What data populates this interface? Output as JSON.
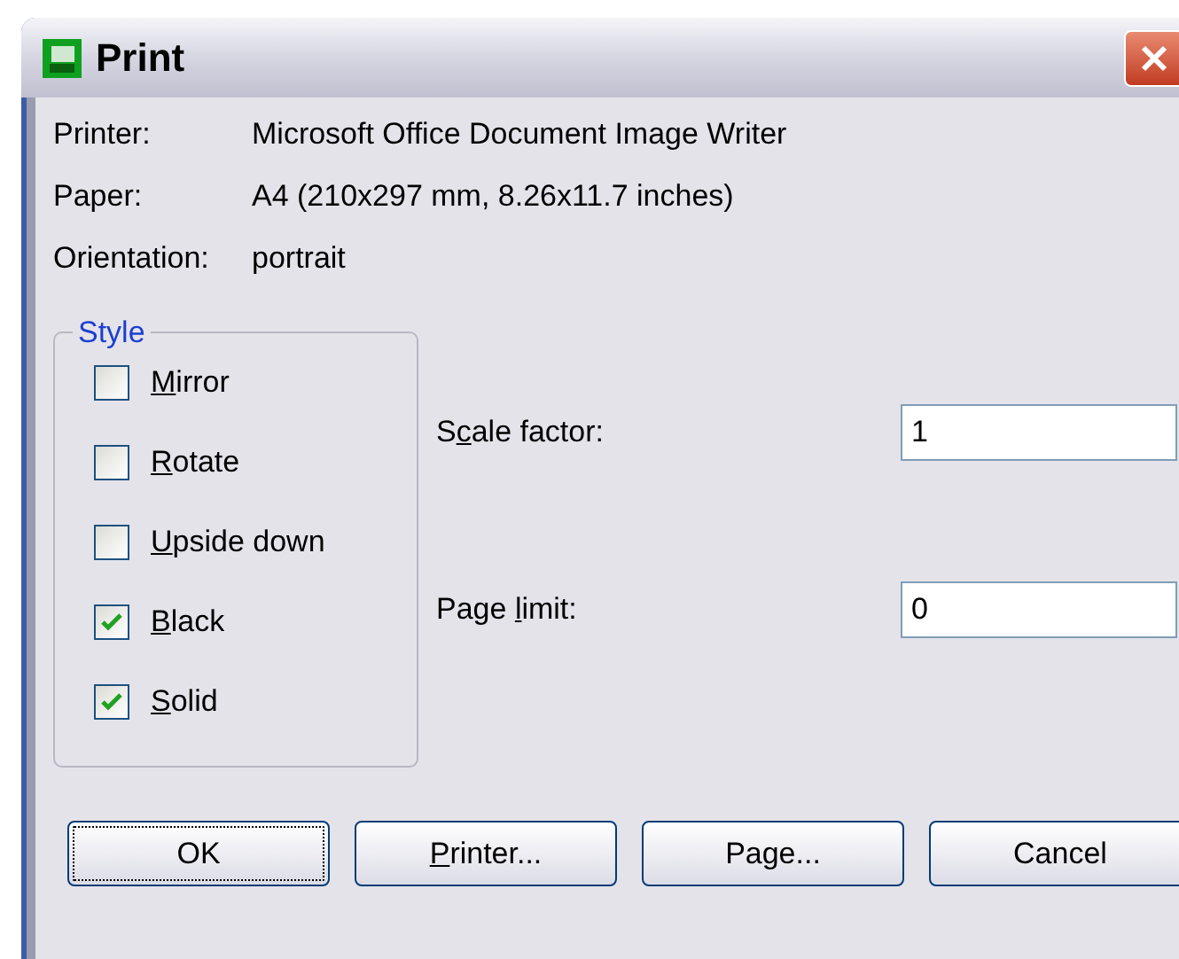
{
  "window": {
    "title": "Print"
  },
  "info": [
    {
      "label": "Printer:",
      "value": "Microsoft Office Document Image Writer"
    },
    {
      "label": "Paper:",
      "value": "A4 (210x297 mm, 8.26x11.7 inches)"
    },
    {
      "label": "Orientation:",
      "value": "portrait"
    }
  ],
  "style_group": {
    "title": "Style",
    "options": [
      {
        "label_parts": [
          {
            "text": "M",
            "underlined": true
          },
          {
            "text": "irror",
            "underlined": false
          }
        ],
        "checked": false
      },
      {
        "label_parts": [
          {
            "text": "R",
            "underlined": true
          },
          {
            "text": "otate",
            "underlined": false
          }
        ],
        "checked": false
      },
      {
        "label_parts": [
          {
            "text": "U",
            "underlined": true
          },
          {
            "text": "pside down",
            "underlined": false
          }
        ],
        "checked": false
      },
      {
        "label_parts": [
          {
            "text": "B",
            "underlined": true
          },
          {
            "text": "lack",
            "underlined": false
          }
        ],
        "checked": true
      },
      {
        "label_parts": [
          {
            "text": "S",
            "underlined": true
          },
          {
            "text": "olid",
            "underlined": false
          }
        ],
        "checked": true
      }
    ]
  },
  "fields": [
    {
      "label_parts": [
        {
          "text": "S",
          "underlined": false
        },
        {
          "text": "c",
          "underlined": true
        },
        {
          "text": "ale factor:",
          "underlined": false
        }
      ],
      "value": "1"
    },
    {
      "label_parts": [
        {
          "text": "Page ",
          "underlined": false
        },
        {
          "text": "l",
          "underlined": true
        },
        {
          "text": "imit:",
          "underlined": false
        }
      ],
      "value": "0"
    }
  ],
  "buttons": [
    {
      "label_parts": [
        {
          "text": "OK",
          "underlined": false
        }
      ],
      "focused": true
    },
    {
      "label_parts": [
        {
          "text": "P",
          "underlined": true
        },
        {
          "text": "rinter...",
          "underlined": false
        }
      ],
      "focused": false
    },
    {
      "label_parts": [
        {
          "text": "Page...",
          "underlined": false
        }
      ],
      "focused": false
    },
    {
      "label_parts": [
        {
          "text": "Cancel",
          "underlined": false
        }
      ],
      "focused": false
    }
  ]
}
